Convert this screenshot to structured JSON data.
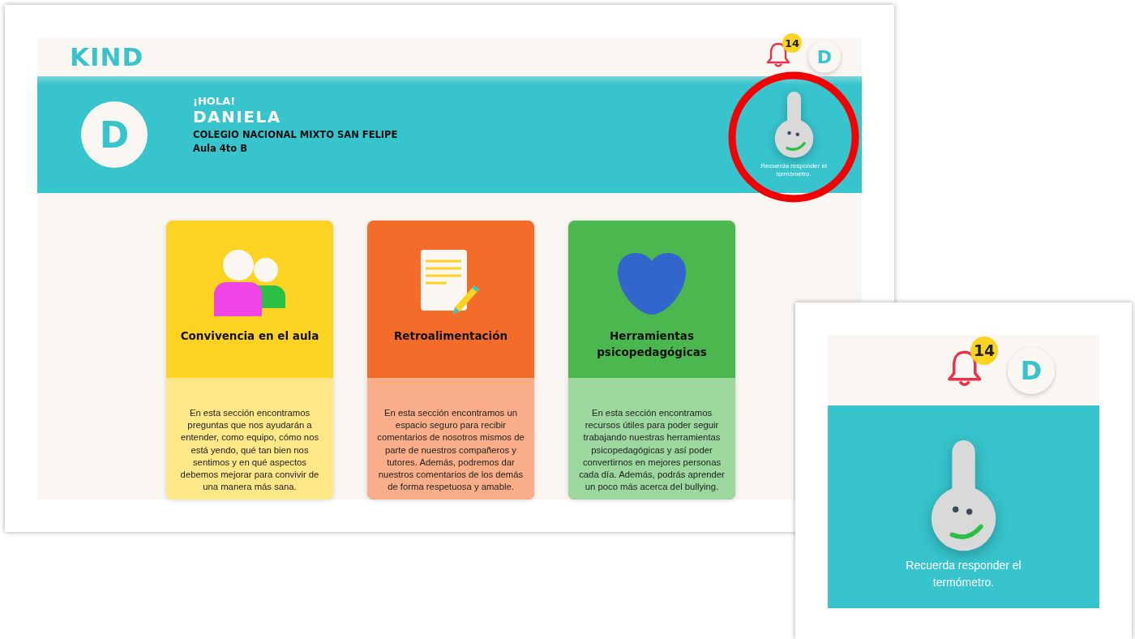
{
  "main_screenshot": {
    "header": {
      "logo": "KIND",
      "notifications": {
        "count": "14"
      },
      "avatar_letter": "D"
    },
    "banner": {
      "avatar_letter": "D",
      "greeting": "¡HOLA!",
      "name": "DANIELA",
      "school": "COLEGIO NACIONAL MIXTO SAN FELIPE",
      "classroom": "Aula 4to B",
      "thermometer": {
        "caption": "Recuerda responder el termómetro."
      }
    },
    "cards": [
      {
        "kind": "people",
        "title": "Convivencia en el aula",
        "description": "En esta sección encontramos preguntas que nos ayudarán a entender, como equipo, cómo nos está yendo, qué tan bien nos sentimos y en qué aspectos debemos mejorar para convivir de una manera más sana.",
        "color": "#fdd323"
      },
      {
        "kind": "document",
        "title": "Retroalimentación",
        "description": "En esta sección encontramos un espacio seguro para recibir comentarios de nosotros mismos de parte de nuestros compañeros y tutores. Además, podremos dar nuestros comentarios de los demás de forma respetuosa y amable.",
        "color": "#f46c29"
      },
      {
        "kind": "heart",
        "title": "Herramientas psicopedagógicas",
        "description": "En esta sección encontramos recursos útiles para poder seguir trabajando nuestras herramientas psicopedagógicas y así poder convertirnos en mejores personas cada día. Además, podrás aprender un poco más acerca del bullying.",
        "color": "#4bb84f"
      }
    ]
  },
  "zoom_inset": {
    "header": {
      "notifications": {
        "count": "14"
      },
      "avatar_letter": "D"
    },
    "thermometer": {
      "caption": "Recuerda responder el termómetro."
    }
  }
}
